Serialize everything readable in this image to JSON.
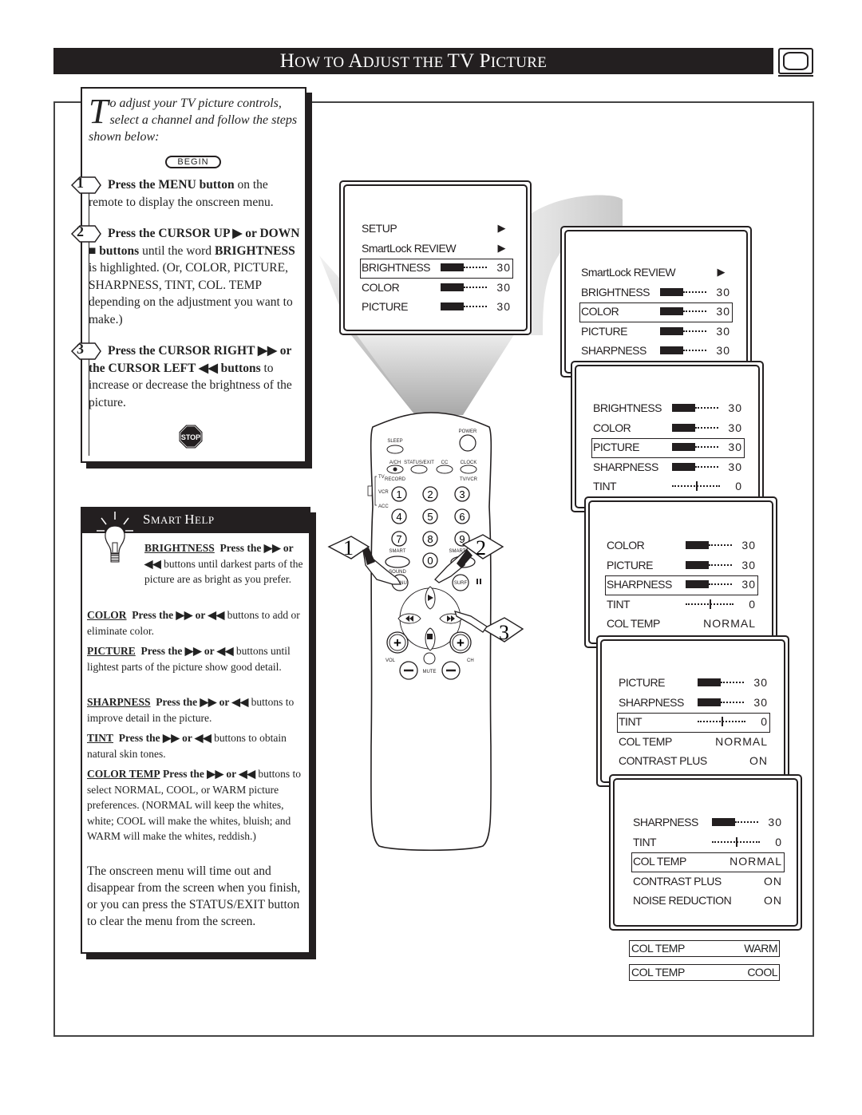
{
  "header": {
    "title_parts": [
      {
        "cap": "H",
        "rest": "OW TO "
      },
      {
        "cap": "A",
        "rest": "DJUST THE "
      },
      {
        "cap": "TV P",
        "rest": "ICTURE"
      }
    ],
    "icon": "tv-icon"
  },
  "steps_panel": {
    "intro_dropcap": "T",
    "intro_text": "o adjust your TV picture controls, select a channel and follow the steps shown below:",
    "begin_label": "BEGIN",
    "steps": [
      {
        "number": "1",
        "bold": "Press the MENU button",
        "text": " on the remote to display the onscreen menu."
      },
      {
        "number": "2",
        "bold": "Press the CURSOR UP ▶ or DOWN ■ buttons",
        "text": " until the word ",
        "bold2": "BRIGHTNESS",
        "text2": " is highlighted. (Or, COLOR, PICTURE, SHARPNESS, TINT, COL. TEMP depending on the adjustment you want to make.)"
      },
      {
        "number": "3",
        "bold": "Press the CURSOR RIGHT ▶▶ or the CURSOR LEFT ◀◀ buttons",
        "text": " to increase or decrease the brightness of the picture."
      }
    ],
    "stop_label": "STOP"
  },
  "smart_help": {
    "title_parts": [
      {
        "cap": "S",
        "rest": "MART "
      },
      {
        "cap": "H",
        "rest": "ELP"
      }
    ],
    "items": [
      {
        "keyword": "BRIGHTNESS",
        "bold": "Press the ▶▶ or ◀◀",
        "text": " buttons until darkest parts of the picture are as bright as you prefer."
      },
      {
        "keyword": "COLOR",
        "bold": "Press the ▶▶ or ◀◀",
        "text": " buttons to add or eliminate color."
      },
      {
        "keyword": "PICTURE",
        "bold": "Press the ▶▶ or ◀◀",
        "text": " buttons until lightest parts of the picture show good detail."
      },
      {
        "keyword": "SHARPNESS",
        "bold": "Press the ▶▶ or ◀◀",
        "text": " buttons to improve detail in the picture."
      },
      {
        "keyword": "TINT",
        "bold": "Press the ▶▶ or ◀◀",
        "text": " buttons to obtain natural skin tones."
      },
      {
        "keyword": "COLOR TEMP",
        "bold": "Press the ▶▶ or ◀◀",
        "text": " buttons to select NORMAL, COOL, or WARM picture preferences. (NORMAL will keep the whites, white; COOL will make the whites, bluish; and WARM will make the whites, reddish.)"
      }
    ],
    "final_note": "The onscreen menu will time out and disappear from the screen when you finish, or you can press the STATUS/EXIT button to clear the menu from the screen."
  },
  "remote": {
    "labels": {
      "power": "POWER",
      "sleep": "SLEEP",
      "ach": "A/CH",
      "status_exit": "STATUS/EXIT",
      "cc": "CC",
      "clock": "CLOCK",
      "record": "RECORD",
      "tvvcr": "TV/VCR",
      "tv": "TV",
      "vcr": "VCR",
      "acc": "ACC",
      "smart_sound": "SMART",
      "sound": "SOUND",
      "smart_pic": "SMART",
      "menu": "MENU",
      "surf": "SURF",
      "vol": "VOL",
      "ch": "CH",
      "mute": "MUTE"
    },
    "digits": [
      "1",
      "2",
      "3",
      "4",
      "5",
      "6",
      "7",
      "8",
      "9",
      "0"
    ],
    "callouts": [
      "1",
      "2",
      "3"
    ]
  },
  "screens": [
    {
      "rows": [
        {
          "label": "SETUP",
          "type": "arrow"
        },
        {
          "label": "SmartLock REVIEW",
          "type": "arrow"
        },
        {
          "label": "BRIGHTNESS",
          "type": "bar",
          "value": "30",
          "fill": 0.5,
          "selected": true
        },
        {
          "label": "COLOR",
          "type": "bar",
          "value": "30",
          "fill": 0.5
        },
        {
          "label": "PICTURE",
          "type": "bar",
          "value": "30",
          "fill": 0.5
        }
      ]
    },
    {
      "rows": [
        {
          "label": "SmartLock REVIEW",
          "type": "arrow"
        },
        {
          "label": "BRIGHTNESS",
          "type": "bar",
          "value": "30",
          "fill": 0.5
        },
        {
          "label": "COLOR",
          "type": "bar",
          "value": "30",
          "fill": 0.5,
          "selected": true
        },
        {
          "label": "PICTURE",
          "type": "bar",
          "value": "30",
          "fill": 0.5
        },
        {
          "label": "SHARPNESS",
          "type": "bar",
          "value": "30",
          "fill": 0.5
        }
      ]
    },
    {
      "rows": [
        {
          "label": "BRIGHTNESS",
          "type": "bar",
          "value": "30",
          "fill": 0.5
        },
        {
          "label": "COLOR",
          "type": "bar",
          "value": "30",
          "fill": 0.5
        },
        {
          "label": "PICTURE",
          "type": "bar",
          "value": "30",
          "fill": 0.5,
          "selected": true
        },
        {
          "label": "SHARPNESS",
          "type": "bar",
          "value": "30",
          "fill": 0.5
        },
        {
          "label": "TINT",
          "type": "tint",
          "value": "0",
          "fill": 0.5
        }
      ]
    },
    {
      "rows": [
        {
          "label": "COLOR",
          "type": "bar",
          "value": "30",
          "fill": 0.5
        },
        {
          "label": "PICTURE",
          "type": "bar",
          "value": "30",
          "fill": 0.5
        },
        {
          "label": "SHARPNESS",
          "type": "bar",
          "value": "30",
          "fill": 0.5,
          "selected": true
        },
        {
          "label": "TINT",
          "type": "tint",
          "value": "0",
          "fill": 0.5
        },
        {
          "label": "COL TEMP",
          "type": "text",
          "value": "NORMAL"
        }
      ]
    },
    {
      "rows": [
        {
          "label": "PICTURE",
          "type": "bar",
          "value": "30",
          "fill": 0.5
        },
        {
          "label": "SHARPNESS",
          "type": "bar",
          "value": "30",
          "fill": 0.5
        },
        {
          "label": "TINT",
          "type": "tint",
          "value": "0",
          "fill": 0.5,
          "selected": true
        },
        {
          "label": "COL TEMP",
          "type": "text",
          "value": "NORMAL"
        },
        {
          "label": "CONTRAST PLUS",
          "type": "text",
          "value": "ON"
        }
      ]
    },
    {
      "rows": [
        {
          "label": "SHARPNESS",
          "type": "bar",
          "value": "30",
          "fill": 0.5
        },
        {
          "label": "TINT",
          "type": "tint",
          "value": "0",
          "fill": 0.5
        },
        {
          "label": "COL TEMP",
          "type": "text",
          "value": "NORMAL",
          "selected": true
        },
        {
          "label": "CONTRAST PLUS",
          "type": "text",
          "value": "ON"
        },
        {
          "label": "NOISE REDUCTION",
          "type": "text",
          "value": "ON"
        }
      ]
    }
  ],
  "col_temp_options": [
    {
      "label": "COL TEMP",
      "value": "WARM"
    },
    {
      "label": "COL TEMP",
      "value": "COOL"
    }
  ]
}
